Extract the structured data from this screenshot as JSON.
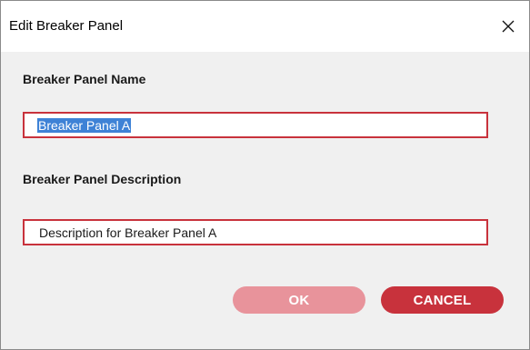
{
  "dialog": {
    "title": "Edit Breaker Panel",
    "close_icon": "close-icon"
  },
  "form": {
    "name_label": "Breaker Panel Name",
    "name_value": "Breaker Panel A",
    "name_selected": true,
    "description_label": "Breaker Panel Description",
    "description_value": "Description for Breaker Panel A"
  },
  "buttons": {
    "ok_label": "OK",
    "ok_state": "disabled",
    "cancel_label": "CANCEL"
  },
  "colors": {
    "accent": "#c8323c",
    "accent_disabled": "#e8939b",
    "selection": "#3e82d6"
  }
}
